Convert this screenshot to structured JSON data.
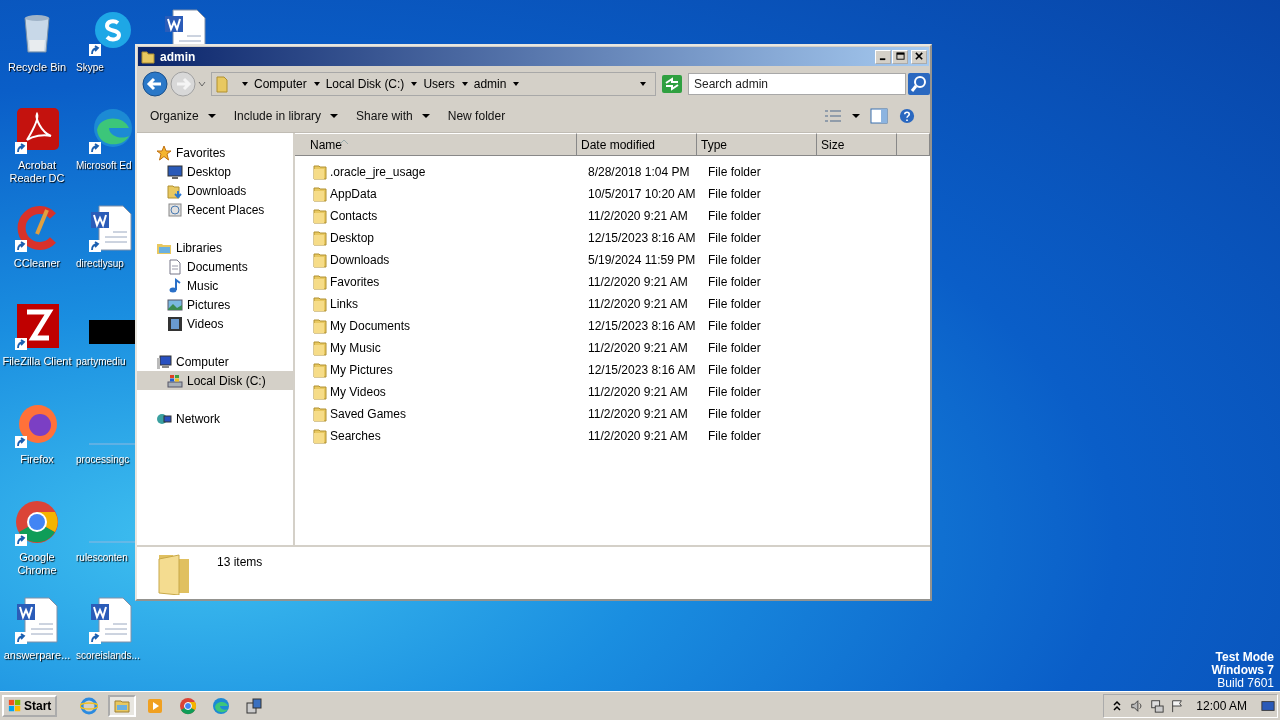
{
  "desktop": {
    "columns": [
      [
        {
          "label": "Recycle Bin",
          "kind": "recycle"
        },
        {
          "label": "Acrobat\nReader DC",
          "kind": "acrobat"
        },
        {
          "label": "CCleaner",
          "kind": "ccleaner"
        },
        {
          "label": "FileZilla Client",
          "kind": "filezilla"
        },
        {
          "label": "Firefox",
          "kind": "firefox"
        },
        {
          "label": "Google\nChrome",
          "kind": "chrome"
        },
        {
          "label": "answerpare...",
          "kind": "word"
        }
      ],
      [
        {
          "label": "Skype",
          "kind": "skype"
        },
        {
          "label": "Microsoft Ed",
          "kind": "edge"
        },
        {
          "label": "directlysup",
          "kind": "word"
        },
        {
          "label": "partymediu",
          "kind": "dark"
        },
        {
          "label": "processingc",
          "kind": "blank"
        },
        {
          "label": "rulesconten",
          "kind": "blank"
        },
        {
          "label": "scoreislands...",
          "kind": "word"
        }
      ],
      [
        {
          "kind": "word"
        }
      ]
    ]
  },
  "explorer": {
    "title": "admin",
    "breadcrumb": [
      "Computer",
      "Local Disk (C:)",
      "Users",
      "admin"
    ],
    "search": {
      "placeholder": "Search admin"
    },
    "toolbar": [
      {
        "label": "Organize",
        "dropdown": true
      },
      {
        "label": "Include in library",
        "dropdown": true
      },
      {
        "label": "Share with",
        "dropdown": true
      },
      {
        "label": "New folder",
        "dropdown": false
      }
    ],
    "nav": [
      {
        "label": "Favorites",
        "kind": "star",
        "selected": false,
        "children": [
          {
            "label": "Desktop",
            "kind": "monitor",
            "selected": false
          },
          {
            "label": "Downloads",
            "kind": "folder",
            "selected": false
          },
          {
            "label": "Recent Places",
            "kind": "recent",
            "selected": false
          }
        ]
      },
      {
        "label": "Libraries",
        "kind": "library",
        "selected": false,
        "children": [
          {
            "label": "Documents",
            "kind": "doc",
            "selected": false
          },
          {
            "label": "Music",
            "kind": "music",
            "selected": false
          },
          {
            "label": "Pictures",
            "kind": "picture",
            "selected": false
          },
          {
            "label": "Videos",
            "kind": "film",
            "selected": false
          }
        ]
      },
      {
        "label": "Computer",
        "kind": "computer",
        "selected": false,
        "children": [
          {
            "label": "Local Disk (C:)",
            "kind": "disk",
            "selected": true
          }
        ]
      },
      {
        "label": "Network",
        "kind": "network",
        "selected": false
      }
    ],
    "columns": [
      {
        "label": "Name",
        "sorted": true
      },
      {
        "label": "Date modified",
        "sorted": false
      },
      {
        "label": "Type",
        "sorted": false
      },
      {
        "label": "Size",
        "sorted": false
      }
    ],
    "rows": [
      {
        "name": ".oracle_jre_usage",
        "date": "8/28/2018 1:04 PM",
        "type": "File folder"
      },
      {
        "name": "AppData",
        "date": "10/5/2017 10:20 AM",
        "type": "File folder"
      },
      {
        "name": "Contacts",
        "date": "11/2/2020 9:21 AM",
        "type": "File folder"
      },
      {
        "name": "Desktop",
        "date": "12/15/2023 8:16 AM",
        "type": "File folder"
      },
      {
        "name": "Downloads",
        "date": "5/19/2024 11:59 PM",
        "type": "File folder"
      },
      {
        "name": "Favorites",
        "date": "11/2/2020 9:21 AM",
        "type": "File folder"
      },
      {
        "name": "Links",
        "date": "11/2/2020 9:21 AM",
        "type": "File folder"
      },
      {
        "name": "My Documents",
        "date": "12/15/2023 8:16 AM",
        "type": "File folder"
      },
      {
        "name": "My Music",
        "date": "11/2/2020 9:21 AM",
        "type": "File folder"
      },
      {
        "name": "My Pictures",
        "date": "12/15/2023 8:16 AM",
        "type": "File folder"
      },
      {
        "name": "My Videos",
        "date": "11/2/2020 9:21 AM",
        "type": "File folder"
      },
      {
        "name": "Saved Games",
        "date": "11/2/2020 9:21 AM",
        "type": "File folder"
      },
      {
        "name": "Searches",
        "date": "11/2/2020 9:21 AM",
        "type": "File folder"
      }
    ],
    "status": "13 items"
  },
  "system_notice": [
    "Test Mode",
    "Windows 7",
    "Build 7601"
  ],
  "taskbar": {
    "start": "Start",
    "apps": [
      {
        "kind": "ie",
        "selected": false
      },
      {
        "kind": "explorer",
        "selected": true
      },
      {
        "kind": "media",
        "selected": false
      },
      {
        "kind": "chrome",
        "selected": false
      },
      {
        "kind": "edge",
        "selected": false
      },
      {
        "kind": "app",
        "selected": false
      }
    ],
    "clock": "12:00 AM"
  }
}
